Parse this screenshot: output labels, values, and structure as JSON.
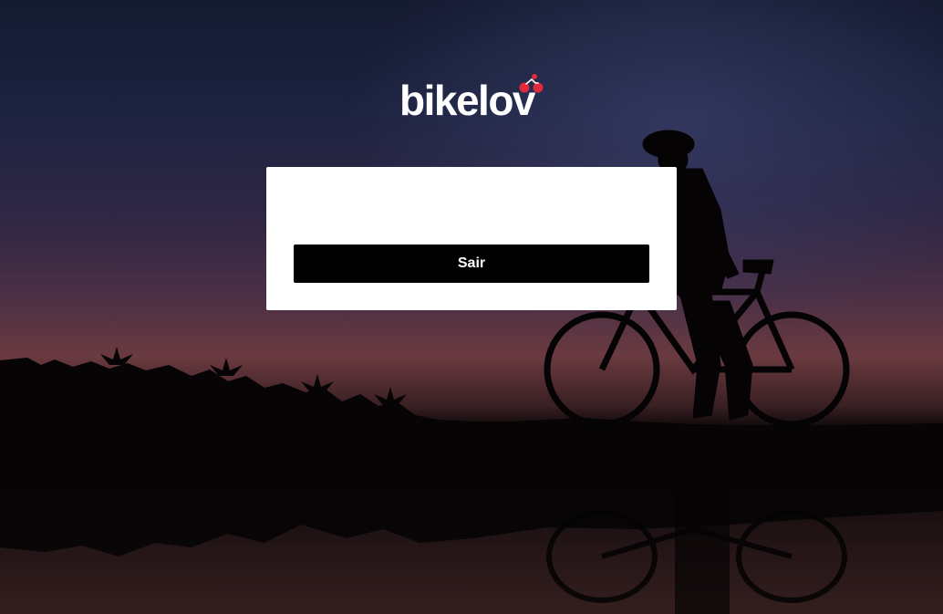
{
  "brand": {
    "name": "bikelov",
    "icon": "cyclist-icon",
    "icon_color": "#e0283e"
  },
  "card": {
    "logout_label": "Sair"
  },
  "colors": {
    "card_background": "#ffffff",
    "button_background": "#000000",
    "button_text": "#ffffff"
  }
}
